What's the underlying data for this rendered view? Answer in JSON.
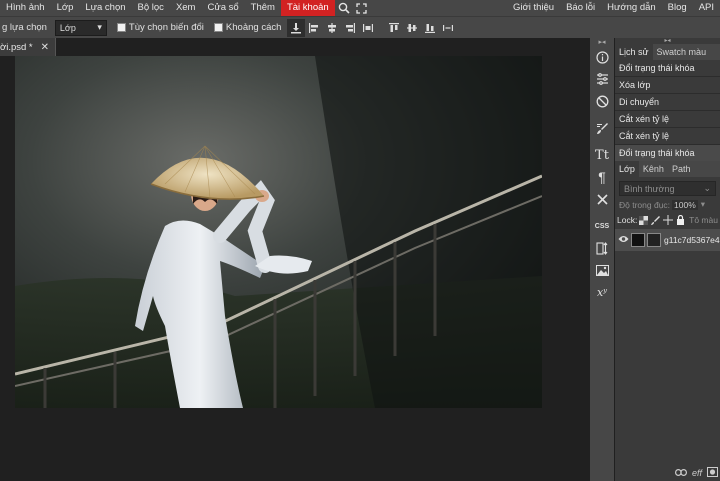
{
  "menu": {
    "items": [
      "Hình ảnh",
      "Lớp",
      "Lựa chọn",
      "Bộ lọc",
      "Xem",
      "Cửa sổ",
      "Thêm",
      "Tài khoản"
    ],
    "right": [
      "Giới thiệu",
      "Báo lỗi",
      "Hướng dẫn",
      "Blog",
      "API"
    ]
  },
  "options": {
    "select_label": "g lựa chọn",
    "mode_value": "Lớp",
    "auto_select": "Tùy chọn biến đổi",
    "distances": "Khoảng cách"
  },
  "doc": {
    "name": "ời.psd *",
    "close": "✕"
  },
  "history": {
    "tabs": [
      "Lịch sử",
      "Swatch màu"
    ],
    "items": [
      "Đổi trạng thái khóa",
      "Xóa lớp",
      "Di chuyển",
      "Cắt xén tỷ lệ",
      "Cắt xén tỷ lệ",
      "Đổi trạng thái khóa"
    ]
  },
  "layers": {
    "tabs": [
      "Lớp",
      "Kênh",
      "Path"
    ],
    "blend_mode": "Bình thường",
    "opacity_label": "Độ trong đục:",
    "opacity_value": "100%",
    "lock_label": "Lock:",
    "fill_label": "Tô màu",
    "layer_name": "g11c7d5367e4"
  },
  "sidetools": {
    "text_tool": "Tt",
    "paragraph": "¶",
    "css": "CSS",
    "glyph": "xʸ"
  },
  "footer": {
    "link": "eff"
  }
}
